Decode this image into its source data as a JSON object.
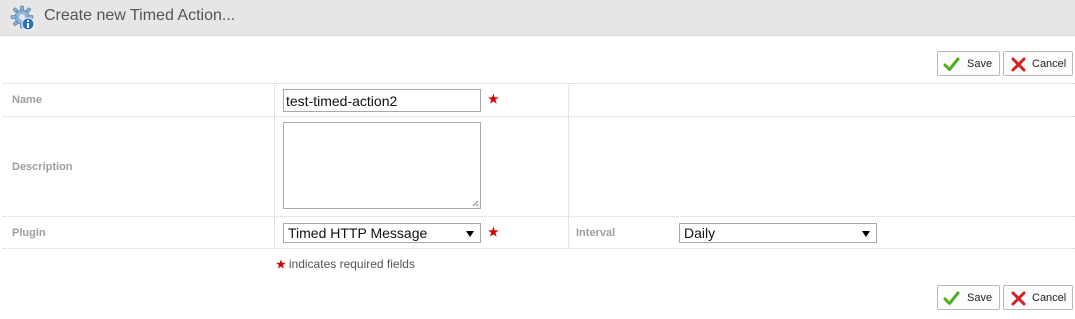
{
  "header": {
    "title": "Create new Timed Action...",
    "icon": "gear-info-icon"
  },
  "toolbar": {
    "save_label": "Save",
    "cancel_label": "Cancel"
  },
  "form": {
    "name_label": "Name",
    "name_value": "test-timed-action2",
    "description_label": "Description",
    "description_value": "",
    "plugin_label": "Plugin",
    "plugin_value": "Timed HTTP Message",
    "interval_label": "Interval",
    "interval_value": "Daily",
    "required_marker": "★",
    "required_note": "indicates required fields"
  },
  "colors": {
    "accent_check": "#4caf1e",
    "accent_cancel": "#d32020",
    "required": "#d40000",
    "header_bg": "#e6e6e6"
  }
}
